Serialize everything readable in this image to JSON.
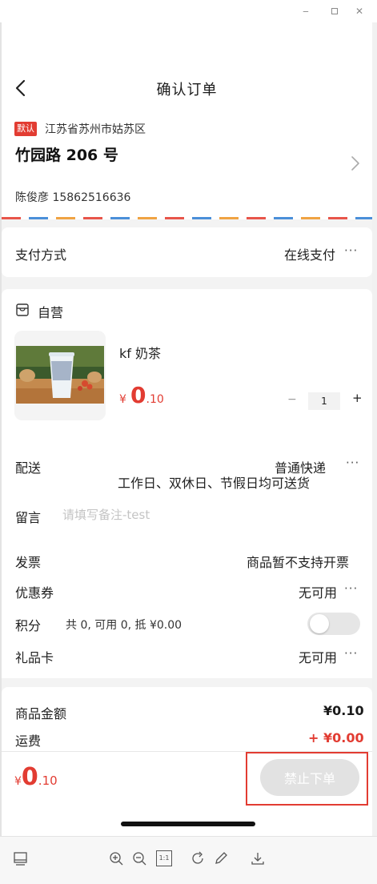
{
  "window": {
    "minimize_label": "‒",
    "close_label": "✕"
  },
  "header": {
    "title": "确认订单"
  },
  "address": {
    "tag": "默认",
    "region": "江苏省苏州市姑苏区",
    "street": "竹园路 206 号",
    "contact": "陈俊彦 15862516636"
  },
  "payment": {
    "label": "支付方式",
    "value": "在线支付",
    "more": "···"
  },
  "product": {
    "store": "自营",
    "name": "kf 奶茶",
    "price_symbol": "¥",
    "price_int": "0",
    "price_dec": ".10",
    "qty_minus": "−",
    "quantity": "1",
    "qty_plus": "+",
    "delivery_label": "配送",
    "delivery_method": "普通快递",
    "delivery_note": "工作日、双休日、节假日均可送货",
    "more": "···"
  },
  "message": {
    "label": "留言",
    "placeholder": "请填写备注-test"
  },
  "options": {
    "invoice_label": "发票",
    "invoice_value": "商品暂不支持开票",
    "coupon_label": "优惠券",
    "coupon_value": "无可用",
    "points_label": "积分",
    "points_info": "共 0, 可用 0, 抵 ¥0.00",
    "points_toggle_on": false,
    "giftcard_label": "礼品卡",
    "giftcard_value": "无可用",
    "more": "···"
  },
  "summary": {
    "goods_label": "商品金额",
    "goods_value": "¥0.10",
    "shipping_label": "运费",
    "shipping_value": "+ ¥0.00"
  },
  "bottom": {
    "total_symbol": "¥",
    "total_int": "0",
    "total_dec": ".10",
    "submit_label": "禁止下单"
  },
  "toolbar": {
    "zoom_reset_label": "1:1"
  },
  "colors": {
    "accent_red": "#e23c32",
    "disabled_button": "#e2e2e2"
  }
}
